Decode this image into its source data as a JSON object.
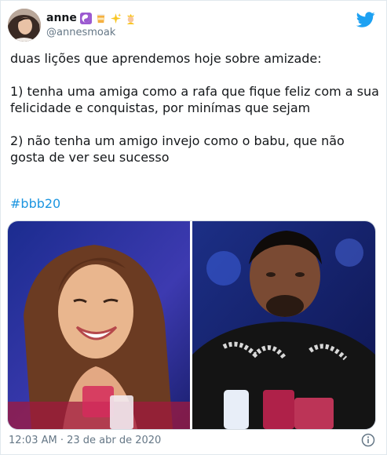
{
  "tweet": {
    "display_name": "anne",
    "handle": "@annesmoak",
    "text": "duas lições que aprendemos hoje sobre amizade:\n\n1) tenha uma amiga como a rafa que fique feliz com a sua felicidade e conquistas, por minímas que sejam\n\n2) não tenha um amigo invejo como o babu, que não gosta de ver seu sucesso",
    "hashtag": "#bbb20",
    "timestamp": "12:03 AM · 23 de abr de 2020",
    "name_emojis": [
      "yin-yang-emoji",
      "cup-emoji",
      "sparkles-emoji",
      "princess-emoji"
    ]
  },
  "icons": {
    "brand": "twitter-bird-icon",
    "info": "info-icon"
  },
  "colors": {
    "link": "#1b95e0",
    "secondary_text": "#657786",
    "brand_blue": "#1da1f2"
  }
}
